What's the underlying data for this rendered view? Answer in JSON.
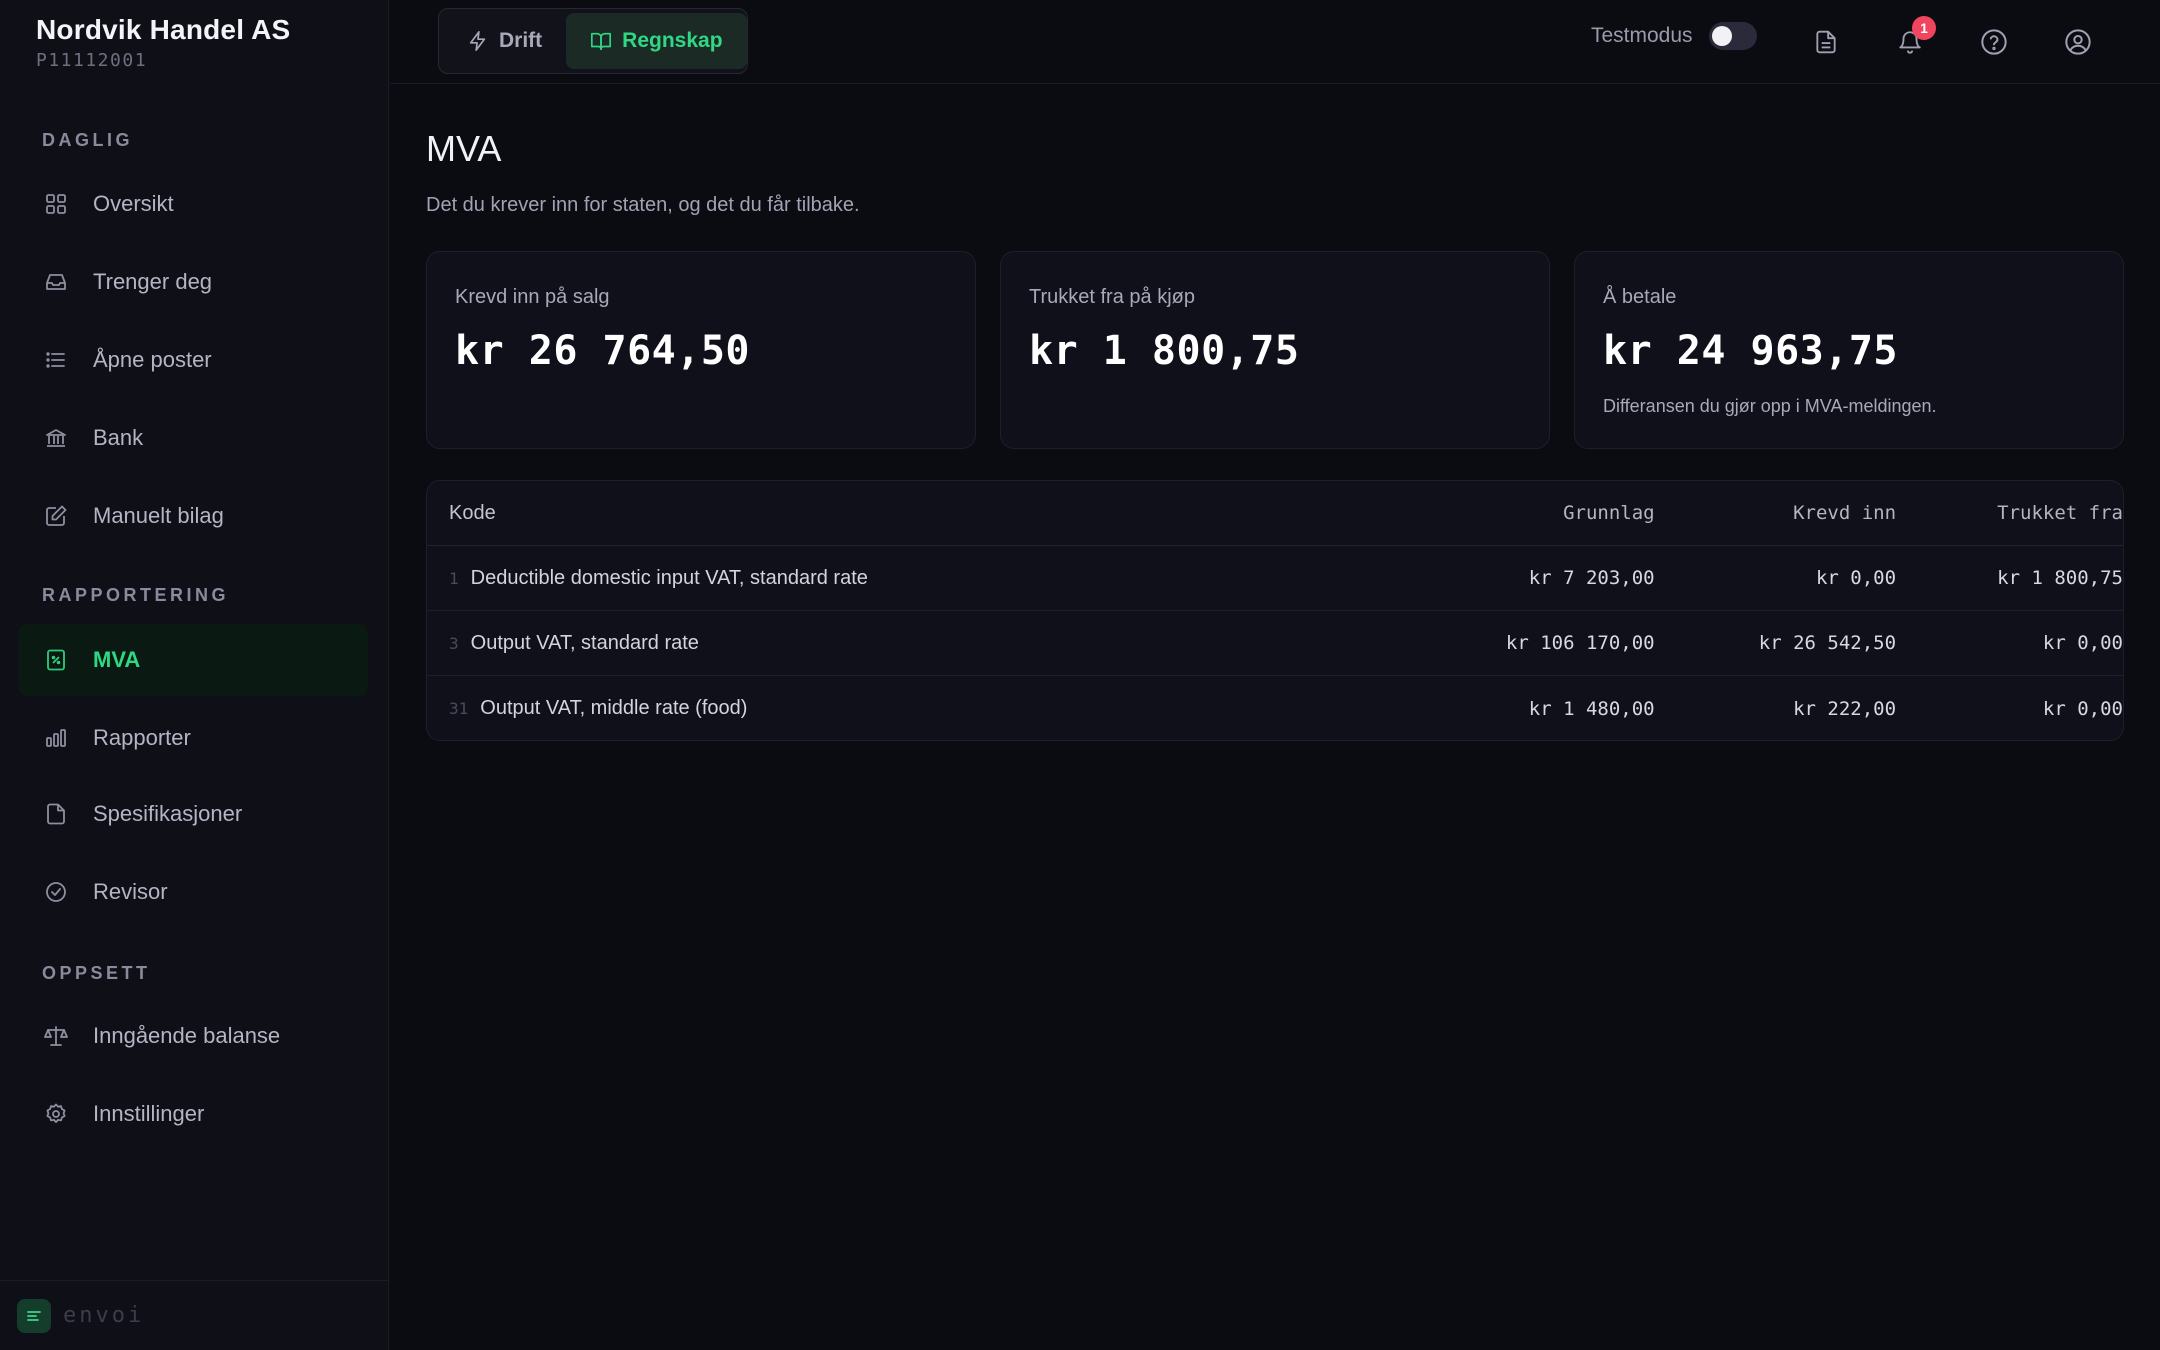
{
  "company": {
    "name": "Nordvik Handel AS",
    "id": "P11112001"
  },
  "sidebar": {
    "sections": [
      {
        "label": "DAGLIG"
      },
      {
        "label": "RAPPORTERING"
      },
      {
        "label": "OPPSETT"
      }
    ],
    "items": [
      {
        "label": "Oversikt",
        "icon": "grid-icon"
      },
      {
        "label": "Trenger deg",
        "icon": "inbox-icon"
      },
      {
        "label": "Åpne poster",
        "icon": "list-icon"
      },
      {
        "label": "Bank",
        "icon": "bank-icon"
      },
      {
        "label": "Manuelt bilag",
        "icon": "edit-icon"
      },
      {
        "label": "MVA",
        "icon": "receipt-percent-icon",
        "active": true
      },
      {
        "label": "Rapporter",
        "icon": "bar-chart-icon"
      },
      {
        "label": "Spesifikasjoner",
        "icon": "file-icon"
      },
      {
        "label": "Revisor",
        "icon": "check-circle-icon"
      },
      {
        "label": "Inngående balanse",
        "icon": "scale-icon"
      },
      {
        "label": "Innstillinger",
        "icon": "gear-icon"
      }
    ],
    "footer_brand": "envoi"
  },
  "topbar": {
    "tabs": [
      {
        "label": "Drift",
        "icon": "bolt-icon"
      },
      {
        "label": "Regnskap",
        "icon": "book-icon",
        "active": true
      }
    ],
    "testmode_label": "Testmodus",
    "testmode_on": false,
    "notification_count": "1"
  },
  "page": {
    "title": "MVA",
    "subtitle": "Det du krever inn for staten, og det du får tilbake."
  },
  "cards": [
    {
      "label": "Krevd inn på salg",
      "value": "kr 26 764,50",
      "note": ""
    },
    {
      "label": "Trukket fra på kjøp",
      "value": "kr 1 800,75",
      "note": ""
    },
    {
      "label": "Å betale",
      "value": "kr 24 963,75",
      "note": "Differansen du gjør opp i MVA-meldingen."
    }
  ],
  "table": {
    "headers": {
      "code": "Kode",
      "basis": "Grunnlag",
      "collected": "Krevd inn",
      "deducted": "Trukket fra"
    },
    "rows": [
      {
        "code": "1",
        "desc": "Deductible domestic input VAT, standard rate",
        "basis": "kr 7 203,00",
        "collected": "kr 0,00",
        "deducted": "kr 1 800,75"
      },
      {
        "code": "3",
        "desc": "Output VAT, standard rate",
        "basis": "kr 106 170,00",
        "collected": "kr 26 542,50",
        "deducted": "kr 0,00"
      },
      {
        "code": "31",
        "desc": "Output VAT, middle rate (food)",
        "basis": "kr 1 480,00",
        "collected": "kr 222,00",
        "deducted": "kr 0,00"
      }
    ]
  },
  "colors": {
    "accent": "#2fd883",
    "badge": "#f0455e",
    "background": "#0b0b12"
  }
}
